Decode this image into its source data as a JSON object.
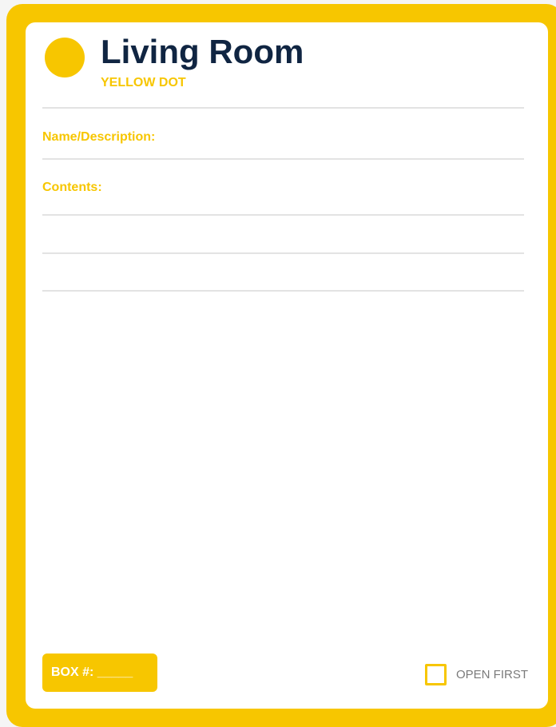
{
  "label": {
    "title": "Living Room",
    "color_code": "YELLOW DOT",
    "dot_color": "#f7c600",
    "accent_color": "#f7c600",
    "title_color": "#102542"
  },
  "fields": {
    "name_label": "Name/Description:",
    "contents_label": "Contents:"
  },
  "footer": {
    "box_number": "BOX #: _____",
    "open_first": "OPEN FIRST",
    "open_first_checked": false
  }
}
